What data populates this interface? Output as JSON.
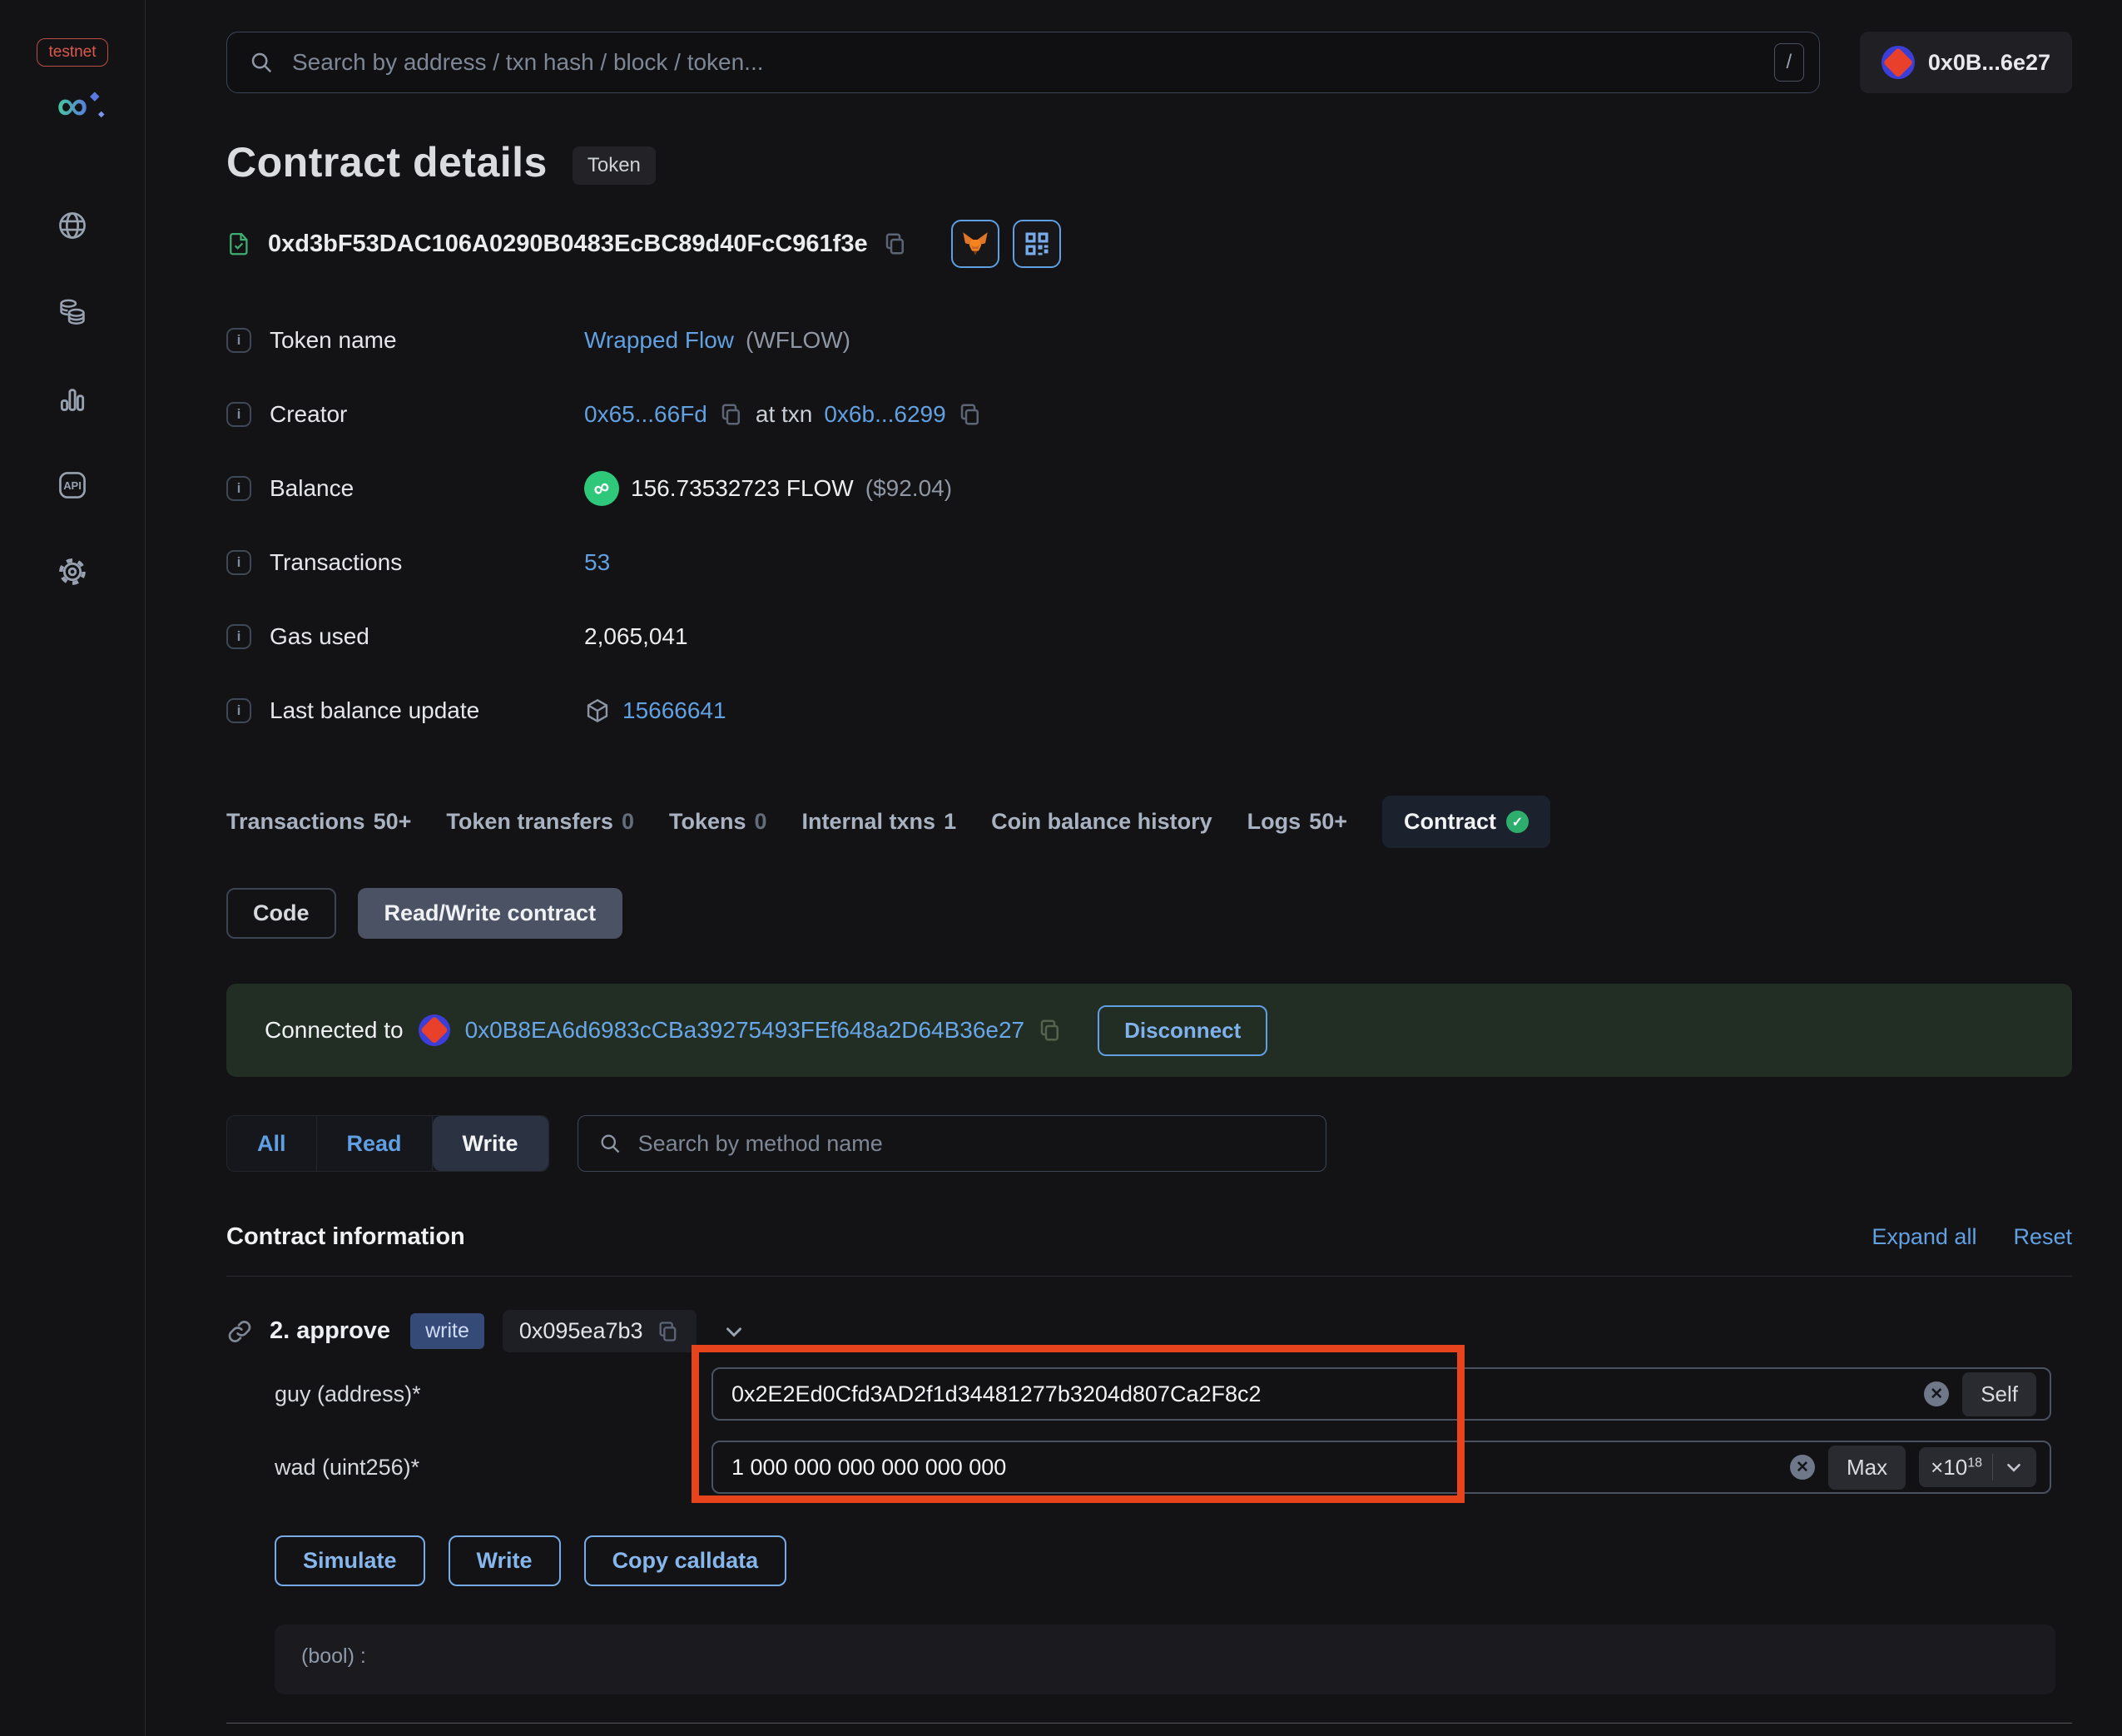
{
  "sidebar": {
    "network_badge": "testnet",
    "api_label": "API"
  },
  "topbar": {
    "search_placeholder": "Search by address / txn hash / block / token...",
    "shortcut_key": "/",
    "wallet_address": "0x0B...6e27"
  },
  "header": {
    "title": "Contract details",
    "type_badge": "Token",
    "contract_address": "0xd3bF53DAC106A0290B0483EcBC89d40FcC961f3e"
  },
  "info": {
    "token_name": {
      "label": "Token name",
      "value": "Wrapped Flow",
      "symbol": "(WFLOW)"
    },
    "creator": {
      "label": "Creator",
      "address": "0x65...66Fd",
      "separator": "at txn",
      "txn": "0x6b...6299"
    },
    "balance": {
      "label": "Balance",
      "amount": "156.73532723 FLOW",
      "usd": "($92.04)"
    },
    "transactions": {
      "label": "Transactions",
      "value": "53"
    },
    "gas_used": {
      "label": "Gas used",
      "value": "2,065,041"
    },
    "last_balance_update": {
      "label": "Last balance update",
      "block": "15666641"
    }
  },
  "tabs": {
    "items": [
      {
        "label": "Transactions",
        "count": "50+"
      },
      {
        "label": "Token transfers",
        "count": "0"
      },
      {
        "label": "Tokens",
        "count": "0"
      },
      {
        "label": "Internal txns",
        "count": "1"
      },
      {
        "label": "Coin balance history",
        "count": ""
      },
      {
        "label": "Logs",
        "count": "50+"
      },
      {
        "label": "Contract",
        "count": ""
      }
    ]
  },
  "subtabs": {
    "code": "Code",
    "read_write": "Read/Write contract"
  },
  "connection": {
    "prefix": "Connected to",
    "address": "0x0B8EA6d6983cCBa39275493FEf648a2D64B36e27",
    "disconnect": "Disconnect"
  },
  "method_filter": {
    "all": "All",
    "read": "Read",
    "write": "Write",
    "search_placeholder": "Search by method name"
  },
  "contract_info": {
    "title": "Contract information",
    "expand_all": "Expand all",
    "reset": "Reset"
  },
  "method": {
    "name": "2. approve",
    "badge": "write",
    "selector": "0x095ea7b3"
  },
  "form": {
    "guy": {
      "label": "guy (address)*",
      "value": "0x2E2Ed0Cfd3AD2f1d34481277b3204d807Ca2F8c2",
      "self": "Self"
    },
    "wad": {
      "label": "wad (uint256)*",
      "value": "1 000 000 000 000 000 000",
      "max": "Max",
      "multiplier": "×10",
      "exponent": "18"
    }
  },
  "actions": {
    "simulate": "Simulate",
    "write": "Write",
    "copy_calldata": "Copy calldata"
  },
  "output": {
    "result": "(bool) :"
  },
  "colors": {
    "accent_blue": "#61a0e1",
    "success_green": "#2eae6c",
    "annotation_red": "#e7431c",
    "testnet_red": "#dd584c",
    "connected_banner_green": "#222d24"
  }
}
